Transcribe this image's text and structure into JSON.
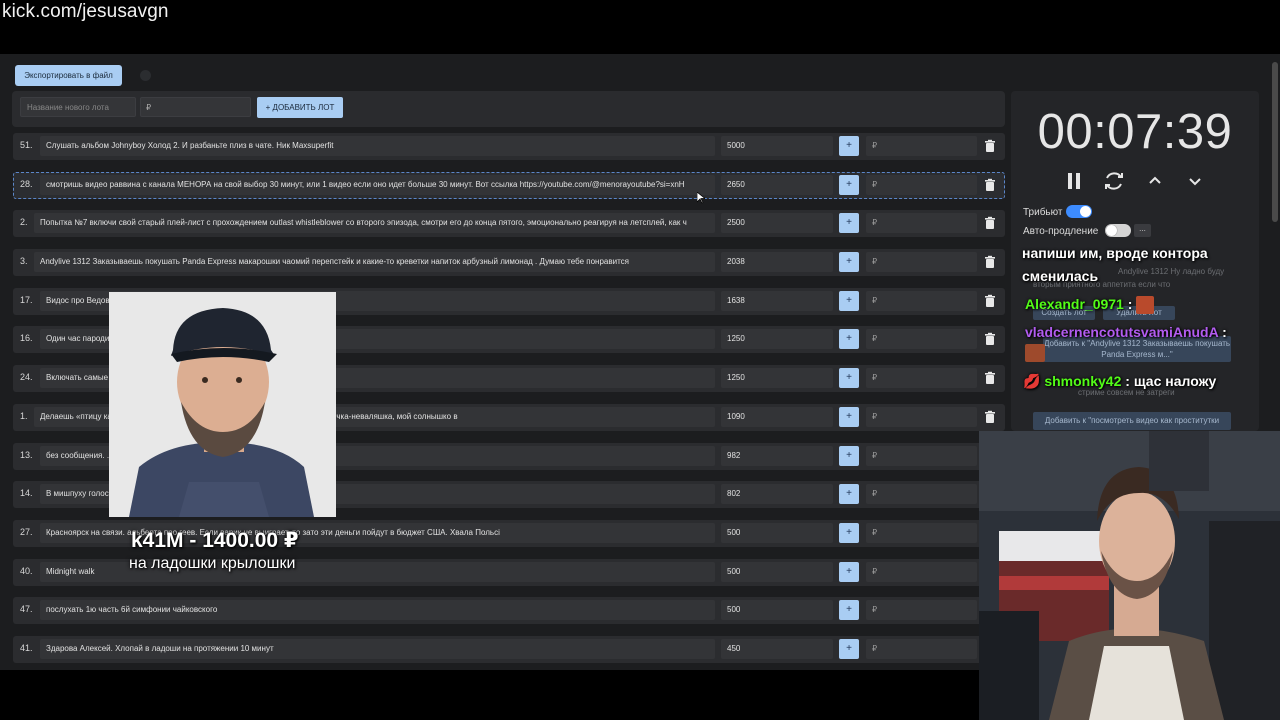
{
  "url": "kick.com/jesusavgn",
  "toolbar": {
    "export_label": "Экспортировать в файл"
  },
  "new_lot": {
    "name_placeholder": "Название нового лота",
    "price_placeholder": "₽",
    "add_label": "+ ДОБАВИТЬ ЛОТ"
  },
  "lots": [
    {
      "num": "51.",
      "text": "Слушать альбом Johnyboy Холод 2. И разбаньте плиз в чате. Ник Maxsuperfit",
      "amount": "5000",
      "price": "₽",
      "text_left": 27
    },
    {
      "num": "28.",
      "text": "смотришь видео раввина с канала МЕНОРА на свой выбор 30 минут, или 1 видео если оно идет больше 30 минут. Вот ссылка https://youtube.com/@menorayoutube?si=xnH",
      "amount": "2650",
      "price": "₽",
      "text_left": 27,
      "selected": true
    },
    {
      "num": "2.",
      "text": "Попытка №7 включи свой старый плей-лист с прохождением outlast whistleblower со второго эпизода, смотри его до конца пятого, эмоционально реагируя на летсплей, как ч",
      "amount": "2500",
      "price": "₽",
      "text_left": 21
    },
    {
      "num": "3.",
      "text": "Andylive 1312 Заказываешь покушать Panda Express макарошки чаомий перепстейк и какие-то креветки напиток арбузный лимонад . Думаю тебе понравится",
      "amount": "2038",
      "price": "₽",
      "text_left": 21
    },
    {
      "num": "17.",
      "text": "Видос про Ведов                                                                                                    3NyDGOlRO",
      "amount": "1638",
      "price": "₽",
      "text_left": 27
    },
    {
      "num": "16.",
      "text": "Один час пароди                                                                                                      его манере",
      "amount": "1250",
      "price": "₽",
      "text_left": 27
    },
    {
      "num": "24.",
      "text": "Включать самые                                                                                                         нцевать и кайфовать",
      "amount": "1250",
      "price": "₽",
      "text_left": 27
    },
    {
      "num": "1.",
      "text": "Делаешь «птицу                                                                                                         камеры прыжками на месте чирикая: «Чирик чирик, я твоя птичка-неваляшка, мой солнышко в",
      "amount": "1090",
      "price": "₽",
      "text_left": 21
    },
    {
      "num": "13.",
      "text": "без сообщения.                                                                                                          .youtube.com/watch?v=ZfAaPOv_j6w",
      "amount": "982",
      "price": "₽",
      "text_left": 27
    },
    {
      "num": "14.",
      "text": "В мишпуху голос                                                                                                         любви",
      "amount": "802",
      "price": "₽",
      "text_left": 27
    },
    {
      "num": "27.",
      "text": "Красноярск на связи.                                                   альберта про геев. Если варик не выиграет, то зато эти деньги пойдут в бюджет США. Хвала Польсі",
      "amount": "500",
      "price": "₽",
      "text_left": 27
    },
    {
      "num": "40.",
      "text": "Midnight walk",
      "amount": "500",
      "price": "₽",
      "text_left": 27
    },
    {
      "num": "47.",
      "text": "послухать 1ю часть 6й симфонии чайковского",
      "amount": "500",
      "price": "₽",
      "text_left": 27
    },
    {
      "num": "41.",
      "text": "Здарова Алексей. Хлопай в ладоши на протяжении 10 минут",
      "amount": "450",
      "price": "₽",
      "text_left": 27
    }
  ],
  "timer": {
    "time": "00:07:39",
    "tribute_label": "Трибьют",
    "auto_label": "Авто-продление",
    "dots": "..."
  },
  "ghost_panel": {
    "line1": "Andylive 1312 Ну ладно буду",
    "line2": "вторым приятного аппетита если что",
    "create_lot": "Создать лот",
    "delete_lot": "Удалить лот",
    "add_to_1": "Добавить к \"Andylive 1312 Заказываешь покушать Panda Express м...\"",
    "add_to_2": "Добавить к \"посмотреть видео как проститутки",
    "line3": "стриме совсем не затреги"
  },
  "chat": [
    {
      "user": "",
      "text": "напиши им, вроде контора",
      "color": "#ffffff"
    },
    {
      "user": "",
      "text": "сменилась",
      "color": "#ffffff"
    },
    {
      "user": "Alexandr_0971",
      "text": " :",
      "color": "#53fc18"
    },
    {
      "user": "vladcernencotutsvamiAnudA",
      "text": " :",
      "color": "#b25cf0"
    },
    {
      "user": "shmonky42",
      "text": " : щас наложу",
      "color": "#53fc18"
    }
  ],
  "donation": {
    "name": "k41M - 1400.00 ₽",
    "message": "на ладошки крылошки"
  },
  "colors": {
    "accent": "#a9cdf3",
    "toggle_on": "#3d8cff",
    "background": "#1c1d1f"
  }
}
